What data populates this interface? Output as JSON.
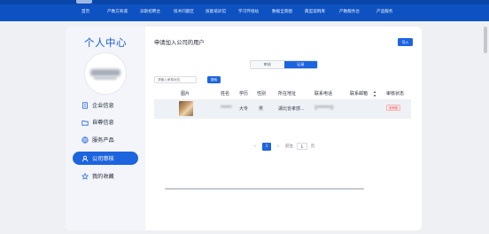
{
  "nav": {
    "items": [
      "首页",
      "产数方商城",
      "派斯招聘台",
      "技术问题区",
      "技能培训馆",
      "学习环境站",
      "数据全景图",
      "典型案例库",
      "产数服务台",
      "产品服务"
    ]
  },
  "sidebar": {
    "title": "个人中心",
    "items": [
      {
        "label": "企业信息",
        "icon": "building-icon"
      },
      {
        "label": "自尊信息",
        "icon": "folder-icon"
      },
      {
        "label": "服务产品",
        "icon": "globe-icon"
      },
      {
        "label": "公司审核",
        "icon": "user-check-icon",
        "active": true
      },
      {
        "label": "我的收藏",
        "icon": "star-icon"
      }
    ]
  },
  "main": {
    "title": "申请加入公司的用户",
    "import_label": "导入",
    "tabs": [
      {
        "label": "审核",
        "active": false
      },
      {
        "label": "记录",
        "active": true
      }
    ],
    "search": {
      "placeholder": "请输入审核状态",
      "button": "搜索"
    },
    "table": {
      "headers": [
        "图片",
        "姓名",
        "学历",
        "性别",
        "所在地址",
        "联系电话",
        "联系邮箱",
        "审核状态"
      ],
      "rows": [
        {
          "name": "*****",
          "education": "大专",
          "gender": "男",
          "address": "湖北省孝感...",
          "phone": "1******2",
          "email": "",
          "status": "未审核"
        }
      ]
    },
    "pagination": {
      "prev": "<",
      "current": "1",
      "next": ">",
      "goto_label": "前往",
      "page_value": "1",
      "page_suffix": "页"
    }
  },
  "colors": {
    "primary": "#1d64df",
    "nav_bg": "#0e52c1",
    "danger": "#e04848"
  }
}
